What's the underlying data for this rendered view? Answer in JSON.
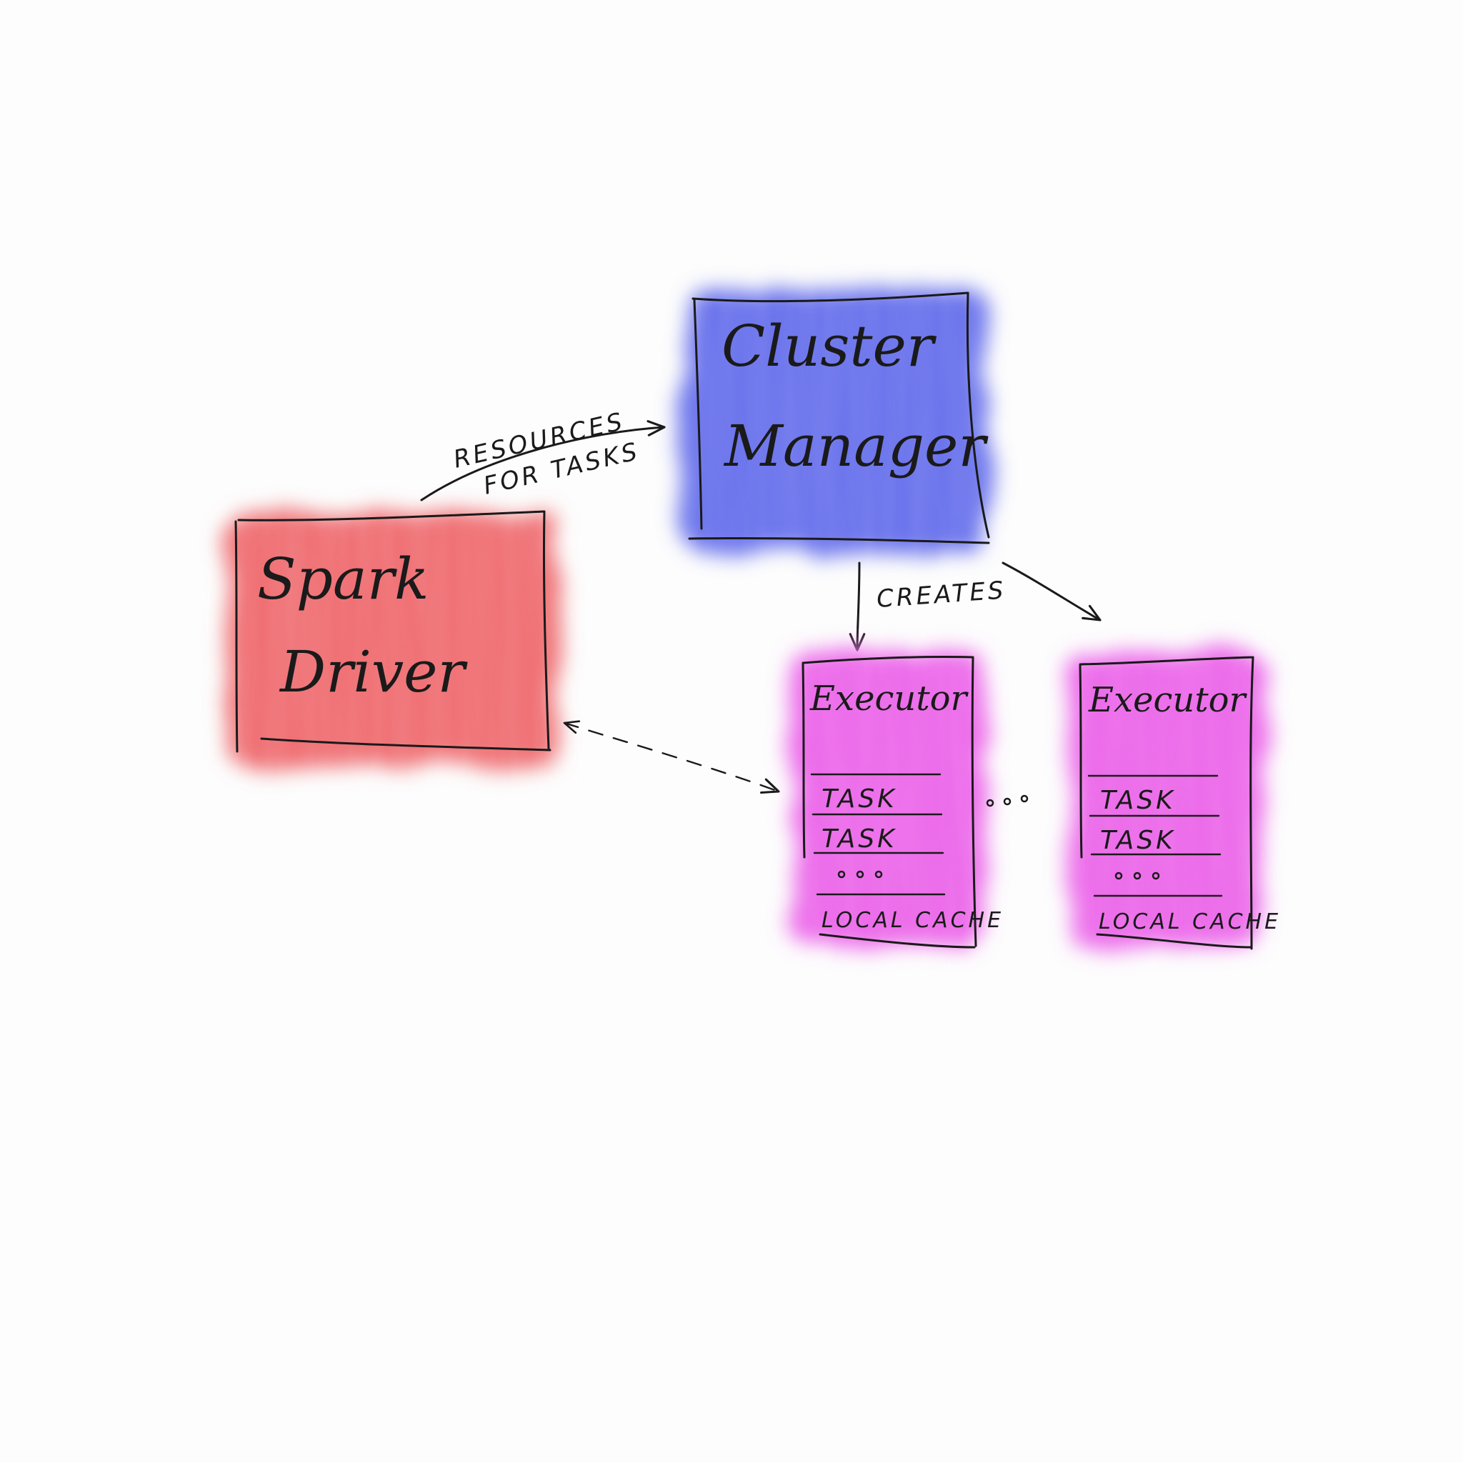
{
  "colors": {
    "background": "#fdfdfd",
    "driver": "#ef6e72",
    "cluster_manager": "#6a73ec",
    "executor": "#ec6aea",
    "ink": "#1a1a1a"
  },
  "driver": {
    "line1": "Spark",
    "line2": "Driver"
  },
  "cluster_manager": {
    "line1": "Cluster",
    "line2": "Manager"
  },
  "edges": {
    "resources_line1": "RESOURCES",
    "resources_line2": "FOR TASKS",
    "creates": "CREATES"
  },
  "executors": [
    {
      "title": "Executor",
      "tasks": [
        "TASK",
        "TASK"
      ],
      "more": "...",
      "cache": "LOCAL CACHE"
    },
    {
      "title": "Executor",
      "tasks": [
        "TASK",
        "TASK"
      ],
      "more": "...",
      "cache": "LOCAL CACHE"
    }
  ],
  "between_executors": "..."
}
